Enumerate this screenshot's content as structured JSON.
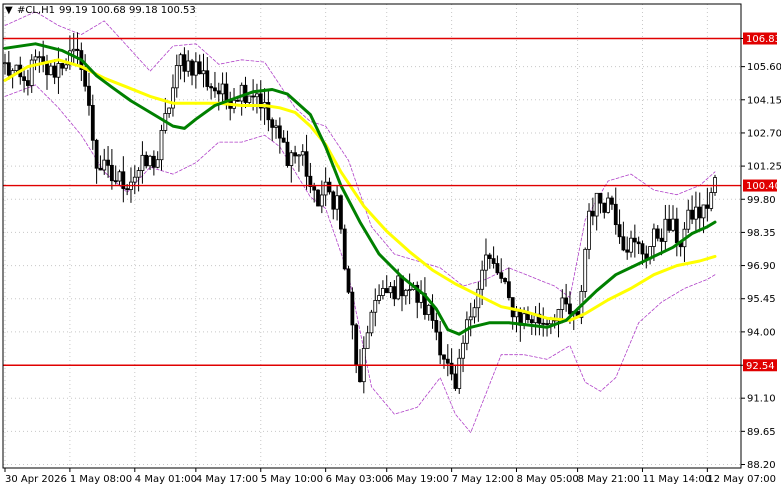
{
  "header": {
    "symbol_label": "#CL,H1",
    "ohlc_text": "99.19 100.68 99.18 100.53",
    "menu_glyph": "▼"
  },
  "colors": {
    "background": "#ffffff",
    "candle": "#000000",
    "grid": "#c8c8c8",
    "level": "#e00000",
    "ma_fast": "#008000",
    "ma_slow": "#ffff00",
    "bands": "#b040c8"
  },
  "chart_data": {
    "type": "candlestick",
    "title": "#CL,H1",
    "grid": true,
    "y_ticks": [
      "106.83",
      "105.60",
      "104.15",
      "102.70",
      "101.25",
      "99.80",
      "98.35",
      "96.90",
      "95.45",
      "94.00",
      "92.54",
      "91.10",
      "89.65",
      "88.20"
    ],
    "ylim": [
      88.2,
      108.0
    ],
    "x_ticks": [
      {
        "label": "30 Apr 2026",
        "bar": 0
      },
      {
        "label": "1 May 08:00",
        "bar": 17
      },
      {
        "label": "4 May 01:00",
        "bar": 34
      },
      {
        "label": "4 May 17:00",
        "bar": 50
      },
      {
        "label": "5 May 10:00",
        "bar": 67
      },
      {
        "label": "6 May 03:00",
        "bar": 84
      },
      {
        "label": "6 May 19:00",
        "bar": 100
      },
      {
        "label": "7 May 12:00",
        "bar": 117
      },
      {
        "label": "8 May 05:00",
        "bar": 134
      },
      {
        "label": "8 May 21:00",
        "bar": 150
      },
      {
        "label": "11 May 14:00",
        "bar": 167
      },
      {
        "label": "12 May 07:00",
        "bar": 184
      }
    ],
    "levels": [
      {
        "label": "106.83",
        "value": 106.83
      },
      {
        "label": "100.40",
        "value": 100.4
      },
      {
        "label": "92.54",
        "value": 92.54
      }
    ],
    "anchors": [
      [
        0,
        105.6
      ],
      [
        5,
        104.8
      ],
      [
        8,
        105.8
      ],
      [
        12,
        105.3
      ],
      [
        16,
        106.0
      ],
      [
        20,
        105.9
      ],
      [
        24,
        101.4
      ],
      [
        28,
        100.7
      ],
      [
        32,
        100.6
      ],
      [
        36,
        101.2
      ],
      [
        40,
        101.6
      ],
      [
        43,
        104.0
      ],
      [
        46,
        105.9
      ],
      [
        50,
        105.6
      ],
      [
        54,
        104.8
      ],
      [
        58,
        104.2
      ],
      [
        62,
        104.6
      ],
      [
        66,
        104.5
      ],
      [
        70,
        102.9
      ],
      [
        74,
        101.8
      ],
      [
        78,
        101.7
      ],
      [
        81,
        99.7
      ],
      [
        84,
        100.1
      ],
      [
        87,
        99.8
      ],
      [
        90,
        95.4
      ],
      [
        93,
        91.5
      ],
      [
        96,
        95.2
      ],
      [
        99,
        95.5
      ],
      [
        102,
        95.9
      ],
      [
        105,
        96.1
      ],
      [
        108,
        95.5
      ],
      [
        112,
        94.6
      ],
      [
        115,
        93.0
      ],
      [
        118,
        91.2
      ],
      [
        120,
        93.4
      ],
      [
        123,
        95.6
      ],
      [
        126,
        97.2
      ],
      [
        129,
        96.6
      ],
      [
        132,
        95.3
      ],
      [
        135,
        94.6
      ],
      [
        138,
        94.6
      ],
      [
        141,
        94.5
      ],
      [
        144,
        94.9
      ],
      [
        147,
        95.0
      ],
      [
        150,
        94.3
      ],
      [
        153,
        99.3
      ],
      [
        156,
        99.8
      ],
      [
        159,
        99.7
      ],
      [
        162,
        98.0
      ],
      [
        165,
        97.7
      ],
      [
        168,
        97.5
      ],
      [
        171,
        98.3
      ],
      [
        174,
        98.6
      ],
      [
        177,
        98.0
      ],
      [
        180,
        99.2
      ],
      [
        183,
        99.2
      ],
      [
        186,
        100.5
      ]
    ],
    "bar_count": 187,
    "ma_fast": [
      [
        0,
        106.4
      ],
      [
        8,
        106.6
      ],
      [
        15,
        106.3
      ],
      [
        20,
        105.9
      ],
      [
        24,
        105.2
      ],
      [
        28,
        104.7
      ],
      [
        33,
        104.1
      ],
      [
        40,
        103.4
      ],
      [
        44,
        103.0
      ],
      [
        47,
        102.9
      ],
      [
        50,
        103.3
      ],
      [
        55,
        103.9
      ],
      [
        60,
        104.2
      ],
      [
        65,
        104.5
      ],
      [
        70,
        104.6
      ],
      [
        74,
        104.4
      ],
      [
        80,
        103.5
      ],
      [
        84,
        102.1
      ],
      [
        88,
        100.4
      ],
      [
        93,
        98.8
      ],
      [
        98,
        97.4
      ],
      [
        104,
        96.4
      ],
      [
        110,
        95.6
      ],
      [
        113,
        95.0
      ],
      [
        116,
        94.1
      ],
      [
        119,
        93.9
      ],
      [
        122,
        94.2
      ],
      [
        127,
        94.4
      ],
      [
        132,
        94.4
      ],
      [
        137,
        94.3
      ],
      [
        142,
        94.2
      ],
      [
        147,
        94.5
      ],
      [
        150,
        95.0
      ],
      [
        155,
        95.8
      ],
      [
        160,
        96.5
      ],
      [
        165,
        96.9
      ],
      [
        170,
        97.3
      ],
      [
        175,
        97.7
      ],
      [
        180,
        98.3
      ],
      [
        184,
        98.6
      ],
      [
        186,
        98.8
      ]
    ],
    "ma_slow": [
      [
        0,
        105.0
      ],
      [
        6,
        105.6
      ],
      [
        14,
        105.9
      ],
      [
        20,
        105.6
      ],
      [
        26,
        105.1
      ],
      [
        32,
        104.7
      ],
      [
        38,
        104.3
      ],
      [
        44,
        104.0
      ],
      [
        50,
        104.0
      ],
      [
        56,
        104.0
      ],
      [
        62,
        103.9
      ],
      [
        68,
        103.9
      ],
      [
        72,
        103.8
      ],
      [
        76,
        103.6
      ],
      [
        80,
        103.0
      ],
      [
        84,
        102.2
      ],
      [
        88,
        101.0
      ],
      [
        94,
        99.5
      ],
      [
        100,
        98.4
      ],
      [
        106,
        97.5
      ],
      [
        112,
        96.7
      ],
      [
        118,
        96.1
      ],
      [
        124,
        95.6
      ],
      [
        130,
        95.1
      ],
      [
        136,
        94.9
      ],
      [
        142,
        94.6
      ],
      [
        148,
        94.5
      ],
      [
        152,
        94.8
      ],
      [
        158,
        95.4
      ],
      [
        164,
        95.9
      ],
      [
        170,
        96.5
      ],
      [
        176,
        96.9
      ],
      [
        182,
        97.1
      ],
      [
        186,
        97.3
      ]
    ],
    "band_upper": [
      [
        0,
        107.4
      ],
      [
        8,
        108.0
      ],
      [
        14,
        107.4
      ],
      [
        20,
        107.0
      ],
      [
        26,
        107.6
      ],
      [
        32,
        106.5
      ],
      [
        38,
        105.4
      ],
      [
        44,
        106.5
      ],
      [
        50,
        106.6
      ],
      [
        56,
        105.7
      ],
      [
        62,
        105.9
      ],
      [
        68,
        105.8
      ],
      [
        72,
        104.8
      ],
      [
        76,
        103.8
      ],
      [
        80,
        103.2
      ],
      [
        84,
        103.0
      ],
      [
        90,
        101.5
      ],
      [
        96,
        98.6
      ],
      [
        102,
        97.4
      ],
      [
        108,
        97.1
      ],
      [
        114,
        96.8
      ],
      [
        120,
        96.0
      ],
      [
        126,
        96.3
      ],
      [
        132,
        96.8
      ],
      [
        138,
        96.4
      ],
      [
        144,
        96.0
      ],
      [
        148,
        95.5
      ],
      [
        152,
        98.9
      ],
      [
        158,
        100.6
      ],
      [
        164,
        100.9
      ],
      [
        170,
        100.2
      ],
      [
        176,
        100.0
      ],
      [
        182,
        100.4
      ],
      [
        186,
        101.0
      ]
    ],
    "band_lower": [
      [
        0,
        104.3
      ],
      [
        8,
        104.8
      ],
      [
        14,
        103.8
      ],
      [
        20,
        102.6
      ],
      [
        26,
        101.0
      ],
      [
        32,
        100.1
      ],
      [
        38,
        101.2
      ],
      [
        44,
        100.9
      ],
      [
        50,
        101.4
      ],
      [
        56,
        102.3
      ],
      [
        62,
        102.3
      ],
      [
        68,
        102.6
      ],
      [
        72,
        102.1
      ],
      [
        76,
        101.0
      ],
      [
        80,
        99.9
      ],
      [
        84,
        99.4
      ],
      [
        90,
        96.5
      ],
      [
        96,
        91.6
      ],
      [
        102,
        90.4
      ],
      [
        108,
        90.7
      ],
      [
        114,
        92.0
      ],
      [
        118,
        90.4
      ],
      [
        122,
        89.6
      ],
      [
        126,
        91.3
      ],
      [
        130,
        93.0
      ],
      [
        136,
        93.0
      ],
      [
        142,
        92.8
      ],
      [
        148,
        93.4
      ],
      [
        152,
        91.8
      ],
      [
        156,
        91.4
      ],
      [
        160,
        92.0
      ],
      [
        166,
        94.4
      ],
      [
        172,
        95.3
      ],
      [
        178,
        95.9
      ],
      [
        184,
        96.3
      ],
      [
        186,
        96.5
      ]
    ]
  }
}
